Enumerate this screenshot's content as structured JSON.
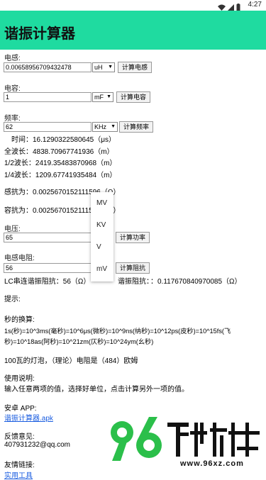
{
  "status": {
    "time": "4:27"
  },
  "app": {
    "title": "谐振计算器"
  },
  "inductance": {
    "label": "电感:",
    "value": "0.00658956709432478",
    "unit": "uH",
    "button": "计算电感"
  },
  "capacitance": {
    "label": "电容:",
    "value": "1",
    "unit": "mF",
    "button": "计算电容"
  },
  "frequency": {
    "label": "频率:",
    "value": "62",
    "unit": "KHz",
    "button": "计算频率"
  },
  "results": {
    "time": "时间：16.1290322580645（μs）",
    "full_wave": "全波长：4838.70967741936（m）",
    "half_wave": "1/2波长：2419.35483870968（m）",
    "quarter_wave": "1/4波长：1209.67741935484（m）",
    "inductive_reactance": "感抗为：0.0025670152111596（Ω）",
    "capacitive_reactance": "容抗为：0.0025670152111596（Ω）"
  },
  "voltage": {
    "label": "电压:",
    "value": "65",
    "unit": "KV",
    "button": "计算功率"
  },
  "resistance": {
    "label": "电感电阻:",
    "value": "56",
    "button": "计算阻抗"
  },
  "dropdown": {
    "options": [
      "MV",
      "KV",
      "V",
      "mV"
    ]
  },
  "impedance": {
    "series": "LC串连谐振阻抗：56（Ω）",
    "parallel_prefix": "谐振阻抗：",
    "parallel": "：0.117670840970085（Ω）"
  },
  "tips": {
    "label": "提示:",
    "units_title": "秒的换算:",
    "units_line1": "1s(秒)=10^3ms(毫秒)=10^6μs(微秒)=10^9ns(纳秒)=10^12ps(皮秒)=10^15fs(飞",
    "units_line2": "秒)=10^18as(阿秒)=10^21zm(仄秒)=10^24ym(幺秒)",
    "bulb": "100瓦的灯泡，（理论）电阻是（484）欧姆",
    "usage_title": "使用说明:",
    "usage": "输入任意两项的值，选择好单位，点击计算另外一项的值。"
  },
  "android": {
    "label": "安卓 APP:",
    "link": "谐振计算器.apk"
  },
  "feedback": {
    "label": "反馈意见:",
    "email": "407931232@qq.com"
  },
  "links": {
    "label": "友情链接:",
    "link": "实用工具"
  },
  "watermark": {
    "brand": "96下载站",
    "url": "www.96xz.com"
  }
}
